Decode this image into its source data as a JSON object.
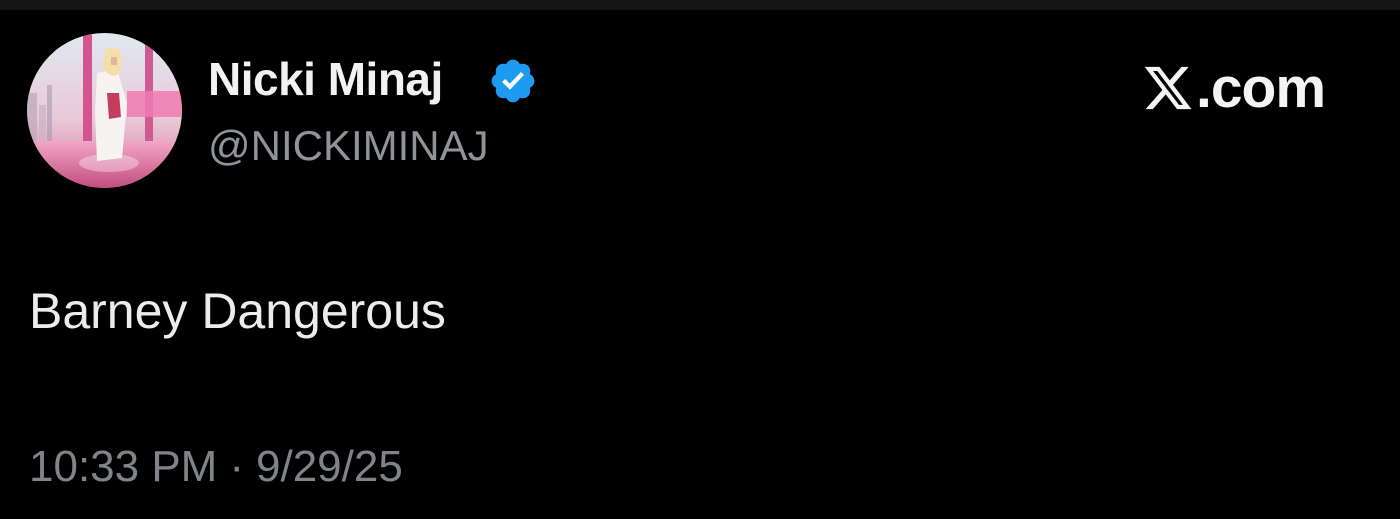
{
  "author": {
    "display_name": "Nicki Minaj",
    "handle": "@NICKIMINAJ",
    "verified": true,
    "verified_color": "#1d9bf0",
    "avatar_icon": "profile-avatar"
  },
  "brand": {
    "text": ".com",
    "icon": "x-logo-icon"
  },
  "tweet": {
    "text": "Barney Dangerous"
  },
  "meta": {
    "time": "10:33 PM",
    "separator": "·",
    "date": "9/29/25"
  }
}
